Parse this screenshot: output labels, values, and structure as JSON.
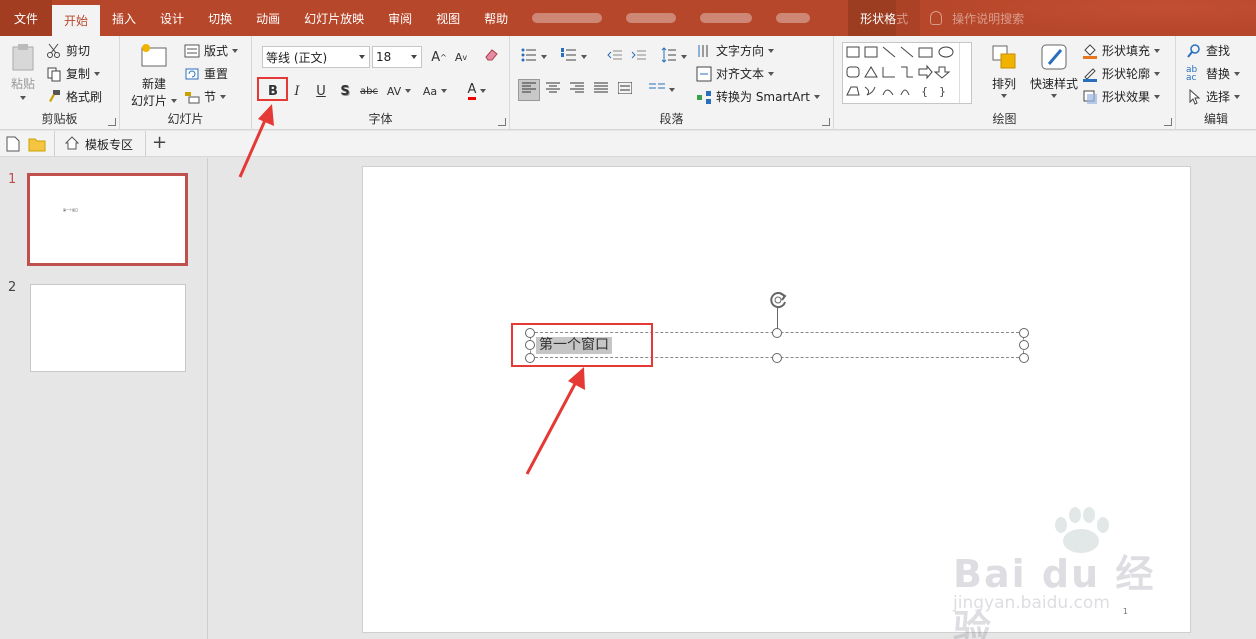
{
  "tabs": {
    "file": "文件",
    "home": "开始",
    "insert": "插入",
    "design": "设计",
    "transitions": "切换",
    "animations": "动画",
    "slideshow": "幻灯片放映",
    "review": "审阅",
    "view": "视图",
    "help": "帮助",
    "shape_format": "形状格式",
    "tell_me": "操作说明搜索"
  },
  "clipboard": {
    "paste": "粘贴",
    "cut": "剪切",
    "copy": "复制",
    "format_painter": "格式刷",
    "label": "剪贴板"
  },
  "slides_group": {
    "new_slide_line1": "新建",
    "new_slide_line2": "幻灯片",
    "layout": "版式",
    "reset": "重置",
    "section": "节",
    "label": "幻灯片"
  },
  "font": {
    "name": "等线 (正文)",
    "size": "18",
    "bold": "B",
    "italic": "I",
    "underline": "U",
    "shadow": "S",
    "strikethrough": "abc",
    "spacing": "AV",
    "case": "Aa",
    "color_letter": "A",
    "grow": "A",
    "label": "字体"
  },
  "paragraph": {
    "text_direction": "文字方向",
    "align_text": "对齐文本",
    "smartart": "转换为 SmartArt",
    "label": "段落"
  },
  "drawing": {
    "arrange": "排列",
    "quick_styles": "快速样式",
    "shape_fill": "形状填充",
    "shape_outline": "形状轮廓",
    "shape_effects": "形状效果",
    "label": "绘图"
  },
  "editing": {
    "find": "查找",
    "replace": "替换",
    "select": "选择",
    "label": "编辑"
  },
  "qat": {
    "template_zone": "模板专区"
  },
  "thumbnails": [
    {
      "number": "1",
      "text": "第一个窗口"
    },
    {
      "number": "2",
      "text": ""
    }
  ],
  "slide": {
    "textbox_text": "第一个窗口",
    "page_number": "1"
  },
  "watermark": {
    "logo": "Bai du 经验",
    "url": "jingyan.baidu.com"
  },
  "colors": {
    "accent": "#b7472a",
    "callout": "#e53935",
    "ribbon_bg": "#f3f3f3"
  }
}
